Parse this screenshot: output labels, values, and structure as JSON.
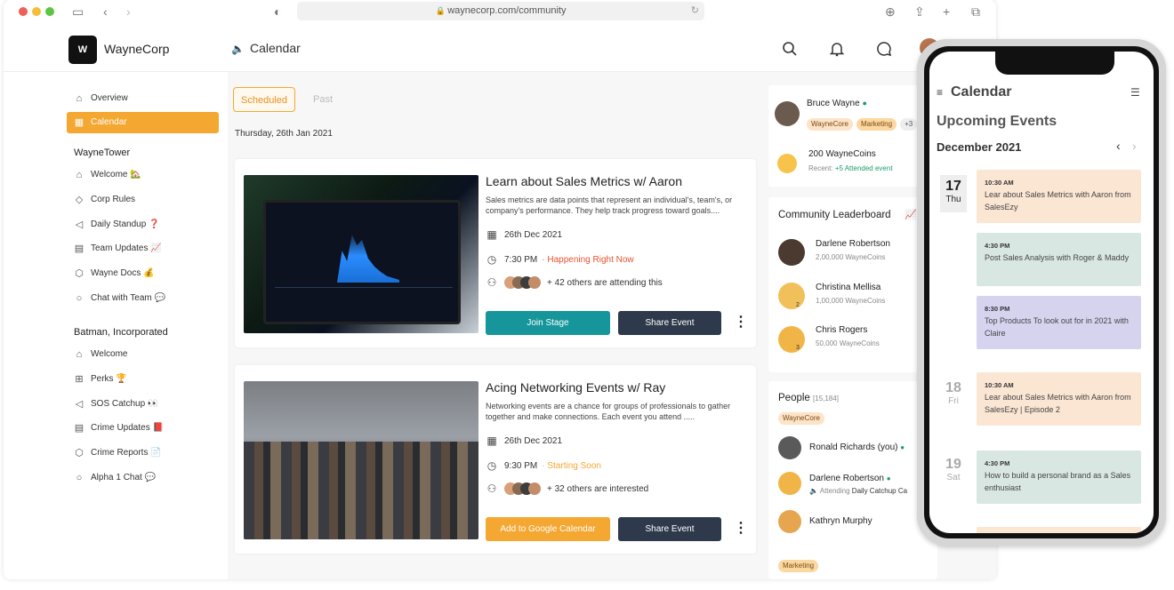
{
  "browser": {
    "url": "waynecorp.com/community"
  },
  "header": {
    "brand": "WayneCorp",
    "logo_text": "W",
    "page_title": "Calendar"
  },
  "sidebar": {
    "top": [
      {
        "label": "Overview",
        "icon": "home-icon"
      },
      {
        "label": "Calendar",
        "icon": "calendar-icon",
        "active": true
      }
    ],
    "sections": [
      {
        "title": "WayneTower",
        "items": [
          {
            "label": "Welcome 🏡",
            "icon": "home-icon"
          },
          {
            "label": "Corp Rules",
            "icon": "shield-icon"
          },
          {
            "label": "Daily Standup ❓",
            "icon": "speaker-icon"
          },
          {
            "label": "Team Updates 📈",
            "icon": "document-icon"
          },
          {
            "label": "Wayne Docs 💰",
            "icon": "cube-icon"
          },
          {
            "label": "Chat with Team 💬",
            "icon": "chat-icon"
          }
        ]
      },
      {
        "title": "Batman, Incorporated",
        "items": [
          {
            "label": "Welcome",
            "icon": "home-icon"
          },
          {
            "label": "Perks 🏆",
            "icon": "gift-icon"
          },
          {
            "label": "SOS Catchup 👀",
            "icon": "speaker-icon"
          },
          {
            "label": "Crime Updates 📕",
            "icon": "document-icon"
          },
          {
            "label": "Crime Reports 📄",
            "icon": "cube-icon"
          },
          {
            "label": "Alpha 1 Chat 💬",
            "icon": "chat-icon"
          }
        ]
      }
    ]
  },
  "tabs": [
    {
      "label": "Scheduled",
      "active": true
    },
    {
      "label": "Past",
      "active": false
    }
  ],
  "date_heading": "Thursday, 26th Jan 2021",
  "events": [
    {
      "title": "Learn about Sales Metrics w/ Aaron",
      "description": "Sales metrics are data points that represent an individual's, team's, or company's performance. They help track progress toward goals....",
      "date": "26th Dec 2021",
      "time": "7:30 PM",
      "status": "· Happening Right Now",
      "status_color": "#e8532f",
      "attendees": "+ 42 others are attending this",
      "primary_button": "Join Stage",
      "primary_color": "#16969a",
      "secondary_button": "Share Event"
    },
    {
      "title": "Acing Networking Events w/ Ray",
      "description": "Networking events are a chance for groups of professionals to gather together and make connections. Each event you attend .....",
      "date": "26th Dec 2021",
      "time": "9:30 PM",
      "status": "· Starting Soon",
      "status_color": "#f4a731",
      "attendees": "+ 32 others are interested",
      "primary_button": "Add to Google Calendar",
      "primary_color": "#f4a731",
      "secondary_button": "Share Event"
    }
  ],
  "profile": {
    "name": "Bruce Wayne",
    "tags": [
      "WayneCore",
      "Marketing",
      "+3"
    ],
    "coins": "200 WayneCoins",
    "recent_label": "Recent:",
    "recent_value": "+5 Attended event"
  },
  "leaderboard": {
    "title": "Community Leaderboard",
    "entries": [
      {
        "name": "Darlene Robertson",
        "coins": "2,00,000 WayneCoins",
        "rank": "1"
      },
      {
        "name": "Christina Mellisa",
        "coins": "1,00,000 WayneCoins",
        "rank": "2"
      },
      {
        "name": "Chris Rogers",
        "coins": "50,000 WayneCoins",
        "rank": "3"
      }
    ]
  },
  "people": {
    "title": "People",
    "count": "[15,184]",
    "group1": "WayneCore",
    "group2": "Marketing",
    "list": [
      {
        "name": "Ronald Richards (you)",
        "sub_prefix": "",
        "sub": ""
      },
      {
        "name": "Darlene Robertson",
        "sub_prefix": "Attending",
        "sub": "Daily Catchup Ca"
      },
      {
        "name": "Kathryn Murphy",
        "sub_prefix": "",
        "sub": ""
      }
    ]
  },
  "mobile": {
    "title": "Calendar",
    "subtitle": "Upcoming Events",
    "month": "December 2021",
    "days": [
      {
        "num": "17",
        "weekday": "Thu",
        "active": true
      },
      {
        "num": "18",
        "weekday": "Fri",
        "active": false
      },
      {
        "num": "19",
        "weekday": "Sat",
        "active": false
      }
    ],
    "events": [
      {
        "time": "10:30 AM",
        "text": "Lear about Sales Metrics with Aaron from SalesEzy",
        "color": "#fbe6d3"
      },
      {
        "time": "4:30 PM",
        "text": "Post Sales Analysis with Roger & Maddy",
        "color": "#d9e7e3"
      },
      {
        "time": "8:30 PM",
        "text": "Top Products To look out for in 2021 with Claire",
        "color": "#d6d3ef"
      },
      {
        "time": "10:30 AM",
        "text": "Lear about Sales Metrics with Aaron from SalesEzy | Episode 2",
        "color": "#fbe6d3"
      },
      {
        "time": "4:30 PM",
        "text": "How to build a personal brand as a Sales enthusiast",
        "color": "#d9e7e3"
      }
    ]
  },
  "colors": {
    "accent": "#f4a731",
    "teal": "#16969a",
    "navy": "#2e3a4b",
    "green": "#1a9e6a"
  }
}
